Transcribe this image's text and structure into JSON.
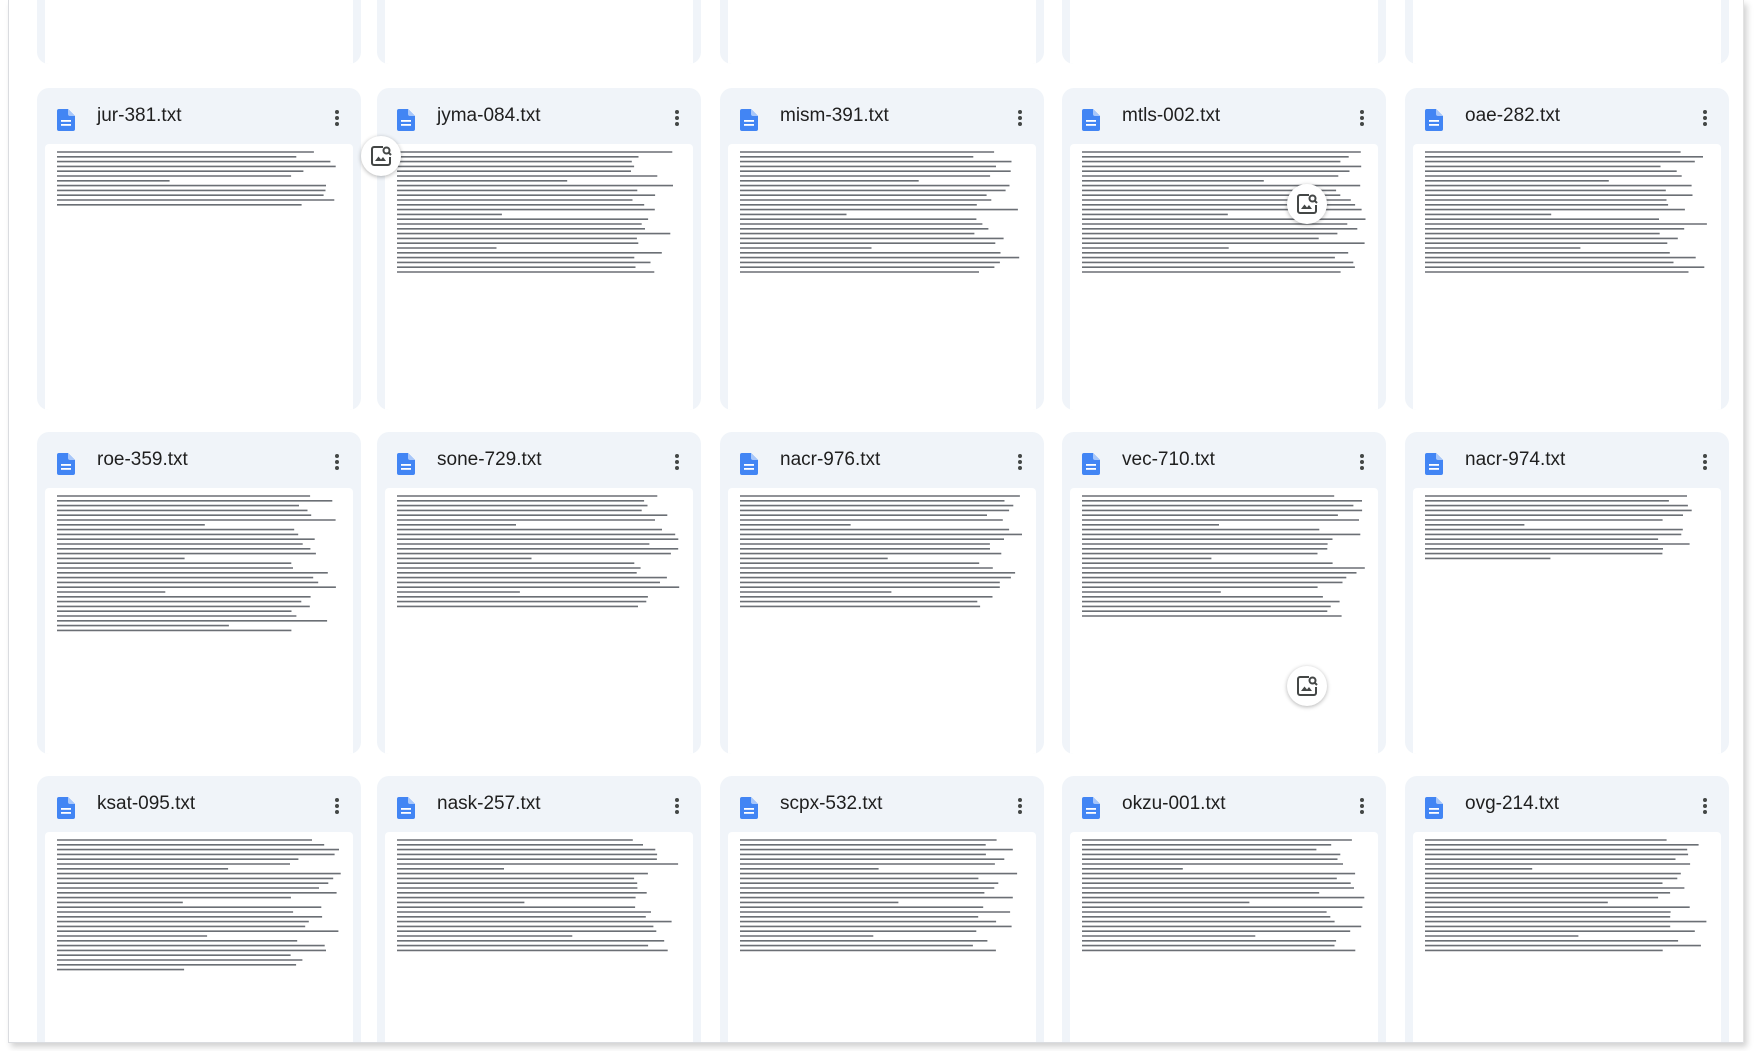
{
  "grid": {
    "files": [
      {
        "name": "",
        "kind": "text-document"
      },
      {
        "name": "",
        "kind": "text-document"
      },
      {
        "name": "",
        "kind": "text-document"
      },
      {
        "name": "",
        "kind": "text-document"
      },
      {
        "name": "",
        "kind": "text-document"
      },
      {
        "name": "jur-381.txt",
        "kind": "text-document"
      },
      {
        "name": "jyma-084.txt",
        "kind": "text-document",
        "badge": "image-search-icon"
      },
      {
        "name": "mism-391.txt",
        "kind": "text-document"
      },
      {
        "name": "mtls-002.txt",
        "kind": "text-document"
      },
      {
        "name": "oae-282.txt",
        "kind": "text-document",
        "badge": "image-search-icon"
      },
      {
        "name": "roe-359.txt",
        "kind": "text-document"
      },
      {
        "name": "sone-729.txt",
        "kind": "text-document"
      },
      {
        "name": "nacr-976.txt",
        "kind": "text-document"
      },
      {
        "name": "vec-710.txt",
        "kind": "text-document"
      },
      {
        "name": "nacr-974.txt",
        "kind": "text-document",
        "badge": "image-search-icon"
      },
      {
        "name": "ksat-095.txt",
        "kind": "text-document"
      },
      {
        "name": "nask-257.txt",
        "kind": "text-document"
      },
      {
        "name": "scpx-532.txt",
        "kind": "text-document"
      },
      {
        "name": "okzu-001.txt",
        "kind": "text-document"
      },
      {
        "name": "ovg-214.txt",
        "kind": "text-document"
      }
    ]
  },
  "colors": {
    "card_background": "#f0f4f9",
    "doc_icon": "#4285f4",
    "text": "#1f1f1f",
    "menu_dots": "#444746"
  },
  "icons": {
    "file": "text-document-icon",
    "menu": "more-vert-icon",
    "badge": "image-search-icon"
  }
}
